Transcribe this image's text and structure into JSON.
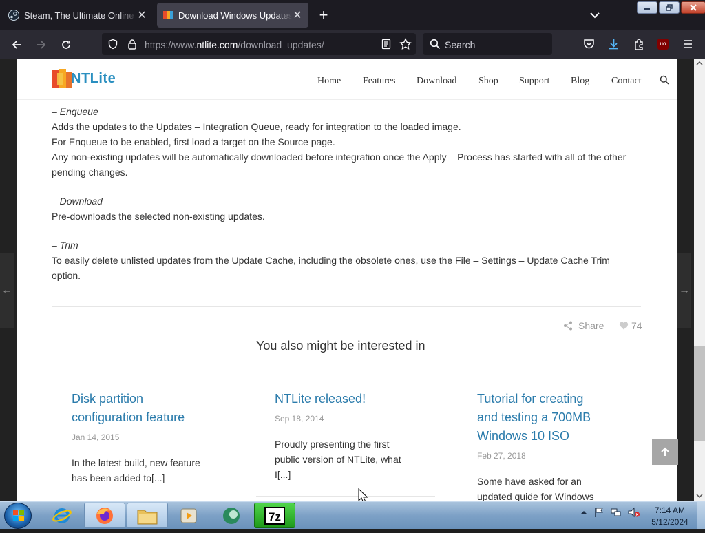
{
  "browser": {
    "tabs": [
      {
        "title": "Steam, The Ultimate Online Game Platform",
        "active": false
      },
      {
        "title": "Download Windows Updates – NTLite",
        "active": true
      }
    ],
    "url_prefix": "https://www.",
    "url_domain": "ntlite.com",
    "url_path": "/download_updates/",
    "search_placeholder": "Search"
  },
  "site": {
    "logo": "NTLite",
    "nav": [
      "Home",
      "Features",
      "Download",
      "Shop",
      "Support",
      "Blog",
      "Contact"
    ]
  },
  "article": {
    "enqueue_title": "– Enqueue",
    "enqueue_lines": [
      "Adds the updates to the Updates – Integration Queue, ready for integration to the loaded image.",
      "For Enqueue to be enabled, first load a target on the Source page.",
      "Any non-existing updates will be automatically downloaded before integration once the Apply – Process has started with all of the other",
      "pending changes."
    ],
    "download_title": "– Download",
    "download_line": "Pre-downloads the selected non-existing updates.",
    "trim_title": "– Trim",
    "trim_lines": [
      "To easily delete unlisted updates from the Update Cache, including the obsolete ones, use the File – Settings – Update Cache Trim",
      "option."
    ]
  },
  "share": {
    "label": "Share",
    "likes": "74"
  },
  "related": {
    "heading": "You also might be interested in",
    "cards": [
      {
        "title_lines": [
          "Disk partition",
          "configuration feature"
        ],
        "date": "Jan 14, 2015",
        "excerpt_lines": [
          "In the latest build, new feature",
          "has been added to[...]"
        ]
      },
      {
        "title_lines": [
          "NTLite released!"
        ],
        "date": "Sep 18, 2014",
        "excerpt_lines": [
          "Proudly presenting the first",
          "public version of NTLite, what",
          "I[...]"
        ]
      },
      {
        "title_lines": [
          "Tutorial for creating",
          "and testing a 700MB",
          "Windows 10 ISO"
        ],
        "date": "Feb 27, 2018",
        "excerpt_lines": [
          "Some have asked for an",
          "updated guide for Windows"
        ]
      }
    ]
  },
  "taskbar": {
    "apps": [
      "internet-explorer",
      "firefox",
      "file-explorer",
      "media-player",
      "edge-like-app",
      "7-zip"
    ],
    "time": "7:14 AM",
    "date": "5/12/2024"
  }
}
